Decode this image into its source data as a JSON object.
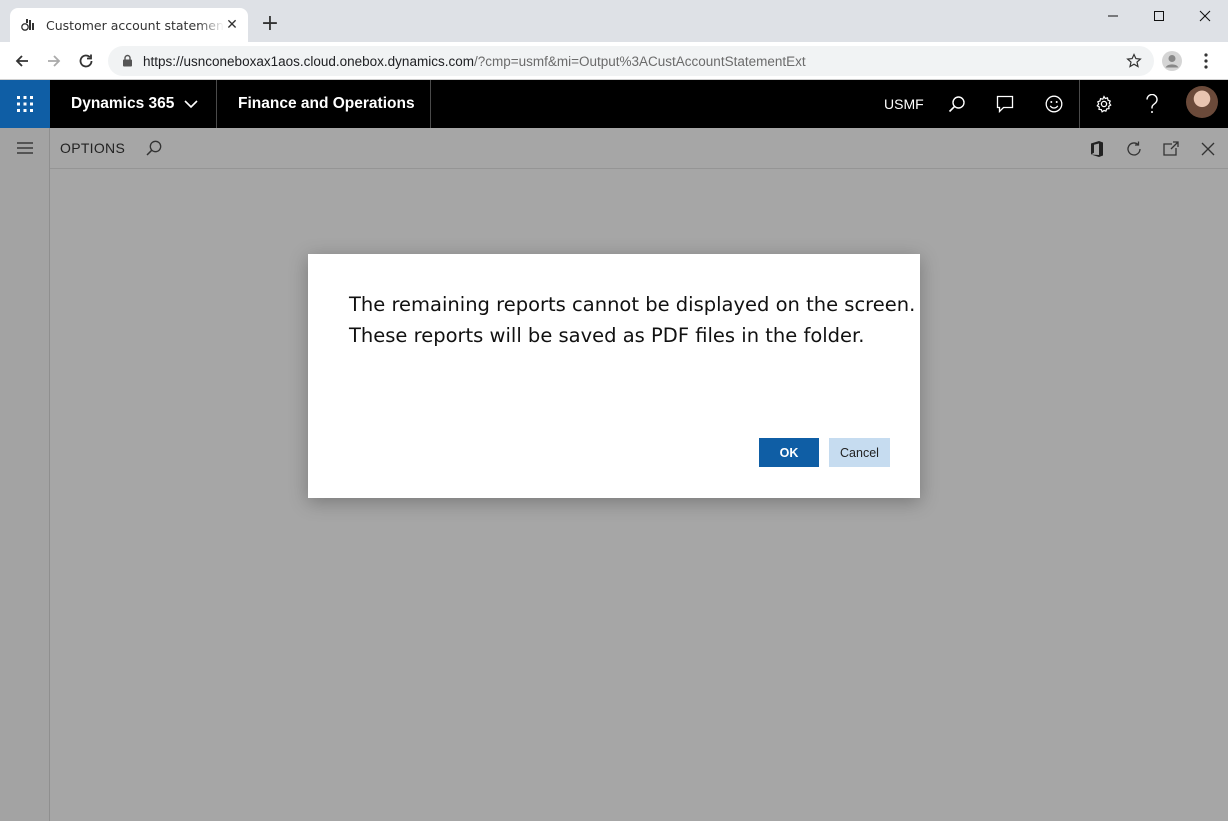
{
  "browser": {
    "tab_title": "Customer account statement -- Finance and Operations",
    "new_tab_label": "+",
    "url_host": "https://usnconeboxax1aos.cloud.onebox.dynamics.com",
    "url_path": "/?cmp=usmf&mi=Output%3ACustAccountStatementExt"
  },
  "navbar": {
    "brand": "Dynamics 365",
    "module": "Finance and Operations",
    "company": "USMF",
    "icons": [
      "search-icon",
      "chat-icon",
      "smiley-icon",
      "gear-icon",
      "help-icon"
    ]
  },
  "action_pane": {
    "options_label": "OPTIONS"
  },
  "dialog": {
    "line1": "The remaining reports cannot be displayed on the screen.",
    "line2": "These reports will be saved as PDF files in the folder.",
    "ok_label": "OK",
    "cancel_label": "Cancel"
  },
  "colors": {
    "brand_blue": "#0f5ea5",
    "navbar_bg": "#000000",
    "overlay_gray": "#a6a6a6",
    "cancel_bg": "#c6dcf0"
  }
}
